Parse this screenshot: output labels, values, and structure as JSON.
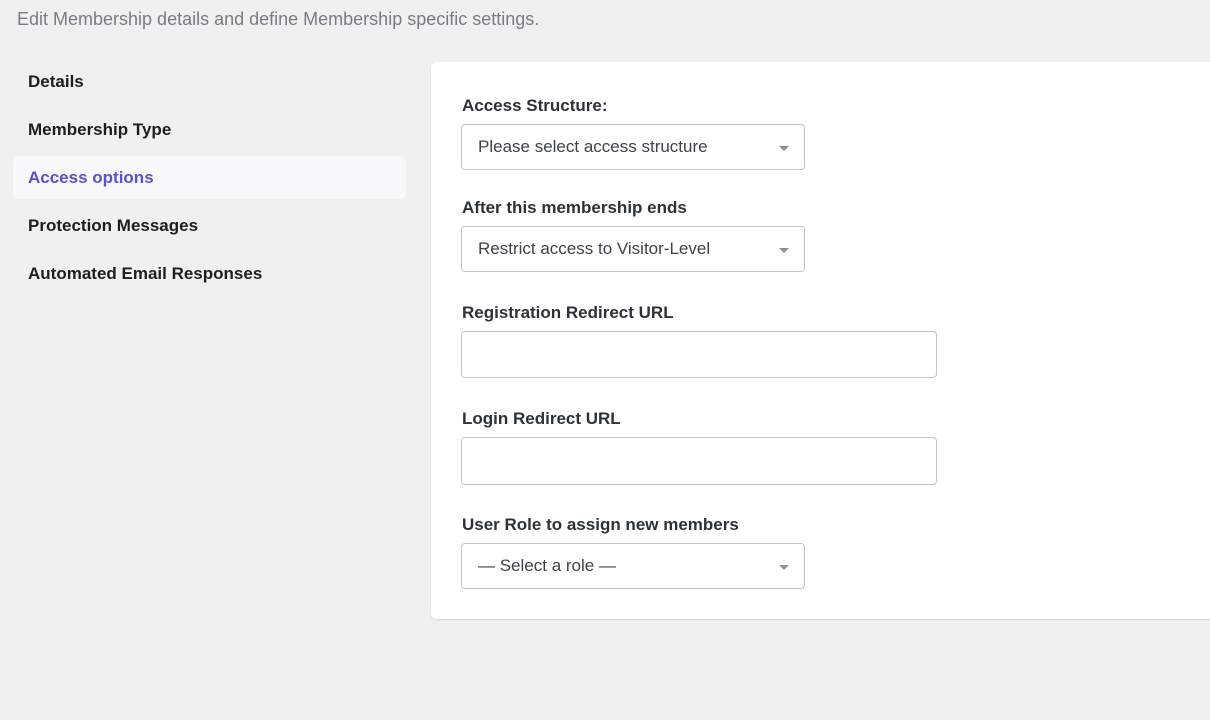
{
  "header": {
    "description": "Edit Membership details and define Membership specific settings."
  },
  "sidebar": {
    "items": [
      {
        "label": "Details",
        "active": false
      },
      {
        "label": "Membership Type",
        "active": false
      },
      {
        "label": "Access options",
        "active": true
      },
      {
        "label": "Protection Messages",
        "active": false
      },
      {
        "label": "Automated Email Responses",
        "active": false
      }
    ]
  },
  "form": {
    "access_structure": {
      "label": "Access Structure:",
      "value": "Please select access structure"
    },
    "after_membership_ends": {
      "label": "After this membership ends",
      "value": "Restrict access to Visitor-Level"
    },
    "registration_redirect": {
      "label": "Registration Redirect URL",
      "value": ""
    },
    "login_redirect": {
      "label": "Login Redirect URL",
      "value": ""
    },
    "user_role": {
      "label": "User Role to assign new members",
      "value": "— Select a role —"
    }
  },
  "colors": {
    "background": "#f0f0f1",
    "active_item": "#5b4fd9",
    "panel": "#ffffff",
    "border": "#c3c4c7"
  }
}
